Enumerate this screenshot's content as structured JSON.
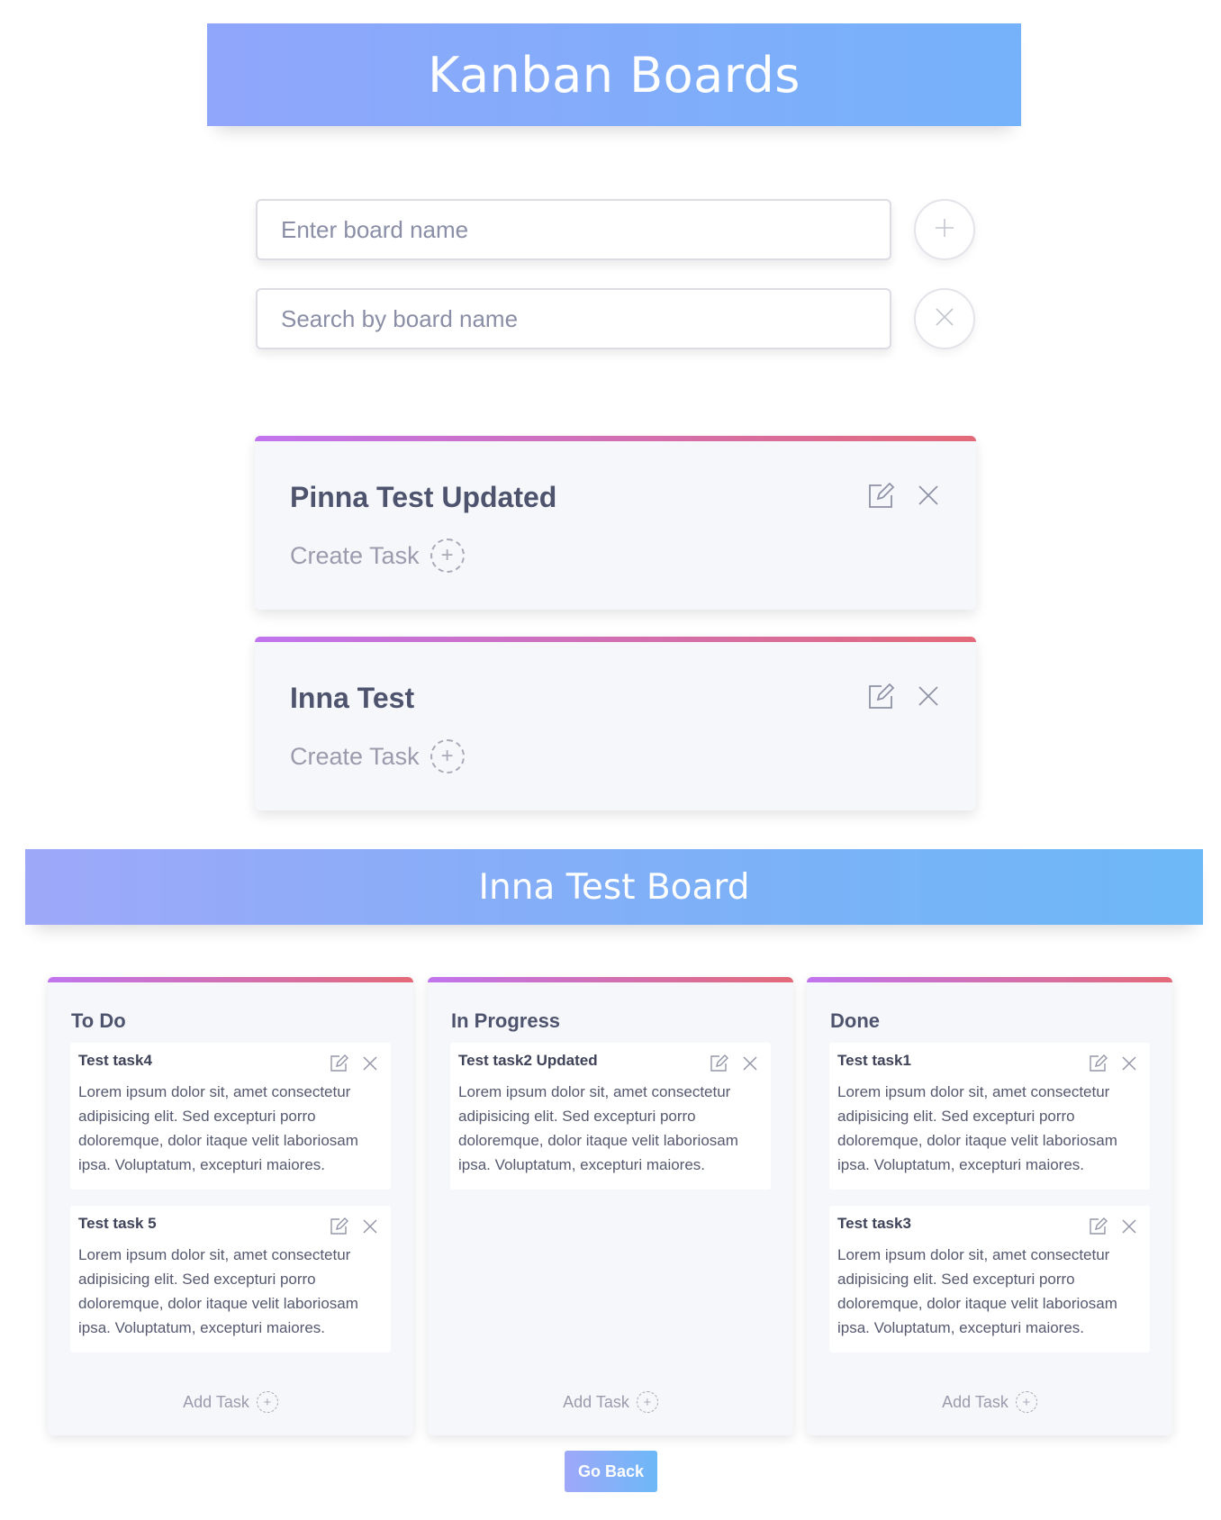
{
  "header": {
    "title": "Kanban Boards"
  },
  "board_name_input": {
    "value": "",
    "placeholder": "Enter board name"
  },
  "search_input": {
    "value": "",
    "placeholder": "Search by board name"
  },
  "icons": {
    "add": "plus-icon",
    "clear": "close-icon",
    "edit": "edit-icon",
    "delete": "close-icon"
  },
  "colors": {
    "header_gradient": [
      "#90a6fb",
      "#75b2f9"
    ],
    "card_accent_gradient": [
      "#c174ee",
      "#e36a78"
    ],
    "card_background": "#f6f7fb"
  },
  "boards": [
    {
      "title": "Pinna Test Updated",
      "create_label": "Create Task"
    },
    {
      "title": "Inna Test",
      "create_label": "Create Task"
    }
  ],
  "board_view": {
    "title": "Inna Test Board",
    "columns": [
      {
        "title": "To Do",
        "add_label": "Add Task",
        "tasks": [
          {
            "title": "Test task4",
            "description": "Lorem ipsum dolor sit, amet consectetur adipisicing elit. Sed excepturi porro doloremque, dolor itaque velit laboriosam ipsa. Voluptatum, excepturi maiores."
          },
          {
            "title": "Test task 5",
            "description": "Lorem ipsum dolor sit, amet consectetur adipisicing elit. Sed excepturi porro doloremque, dolor itaque velit laboriosam ipsa. Voluptatum, excepturi maiores."
          }
        ]
      },
      {
        "title": "In Progress",
        "add_label": "Add Task",
        "tasks": [
          {
            "title": "Test task2 Updated",
            "description": "Lorem ipsum dolor sit, amet consectetur adipisicing elit. Sed excepturi porro doloremque, dolor itaque velit laboriosam ipsa. Voluptatum, excepturi maiores."
          }
        ]
      },
      {
        "title": "Done",
        "add_label": "Add Task",
        "tasks": [
          {
            "title": "Test task1",
            "description": "Lorem ipsum dolor sit, amet consectetur adipisicing elit. Sed excepturi porro doloremque, dolor itaque velit laboriosam ipsa. Voluptatum, excepturi maiores."
          },
          {
            "title": "Test task3",
            "description": "Lorem ipsum dolor sit, amet consectetur adipisicing elit. Sed excepturi porro doloremque, dolor itaque velit laboriosam ipsa. Voluptatum, excepturi maiores."
          }
        ]
      }
    ],
    "go_back_label": "Go Back"
  }
}
